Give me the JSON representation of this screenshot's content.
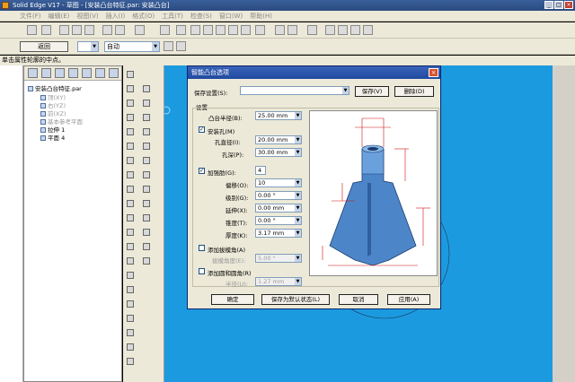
{
  "window": {
    "title": "Solid Edge V17 - 草图 - [安装凸台特征.par: 安装凸台]",
    "controls": [
      "_",
      "□",
      "×"
    ]
  },
  "menubar": {
    "items": [
      "文件(F)",
      "编辑(E)",
      "视图(V)",
      "插入(I)",
      "格式(O)",
      "工具(T)",
      "检查(S)",
      "窗口(W)",
      "帮助(H)"
    ]
  },
  "toolbar2": {
    "back_label": "返回",
    "mode_value": "自动"
  },
  "prompt": "单击属性轮廓的中点。",
  "pathfinder": {
    "root": "安装凸台特征.par",
    "items": [
      {
        "label": "顶(XY)",
        "dim": true
      },
      {
        "label": "右(YZ)",
        "dim": true
      },
      {
        "label": "前(XZ)",
        "dim": true
      },
      {
        "label": "基本参考平面",
        "dim": true
      },
      {
        "label": "拉伸 1",
        "dim": false
      },
      {
        "label": "平面 4",
        "dim": false
      }
    ]
  },
  "dialog": {
    "title": "智能凸台选项",
    "close": "×",
    "save_settings_label": "保存设置(S):",
    "save_settings_value": "",
    "save_button": "保存(V)",
    "delete_button": "删除(D)",
    "settings_group": "设置",
    "boss_radius_label": "凸台半径(B):",
    "boss_radius_value": "25.00 mm",
    "hole_checkbox": "安装孔(M)",
    "hole_checked": true,
    "hole_dia_label": "孔直径(I):",
    "hole_dia_value": "20.00 mm",
    "hole_depth_label": "孔深(P):",
    "hole_depth_value": "30.00 mm",
    "rib_checkbox": "加强肋(G):",
    "rib_checked": true,
    "rib_count": "4",
    "offset_label": "偏移(O):",
    "offset_value": "10",
    "level_label": "级别(G):",
    "level_value": "0.00 °",
    "extend_label": "延伸(X):",
    "extend_value": "0.00 mm",
    "taper_label": "锥度(T):",
    "taper_value": "0.00 °",
    "thickness_label": "厚度(K):",
    "thickness_value": "3.17 mm",
    "draft_checkbox": "添加拔模角(A)",
    "draft_checked": false,
    "draft_label": "拔模角度(E):",
    "draft_value": "5.00 °",
    "fillet_checkbox": "添加圆和圆角(R)",
    "fillet_checked": false,
    "radius_label": "半径(U):",
    "radius_value": "1.27 mm",
    "ok_button": "确定",
    "save_default_button": "保存为默认状态(L)",
    "cancel_button": "取消",
    "apply_button": "应用(A)"
  },
  "colors": {
    "canvas": "#1c9adf",
    "dialog_title": "#1f4aa0",
    "part_fill": "#4d86c8",
    "dimension_lines": "#d01010"
  }
}
